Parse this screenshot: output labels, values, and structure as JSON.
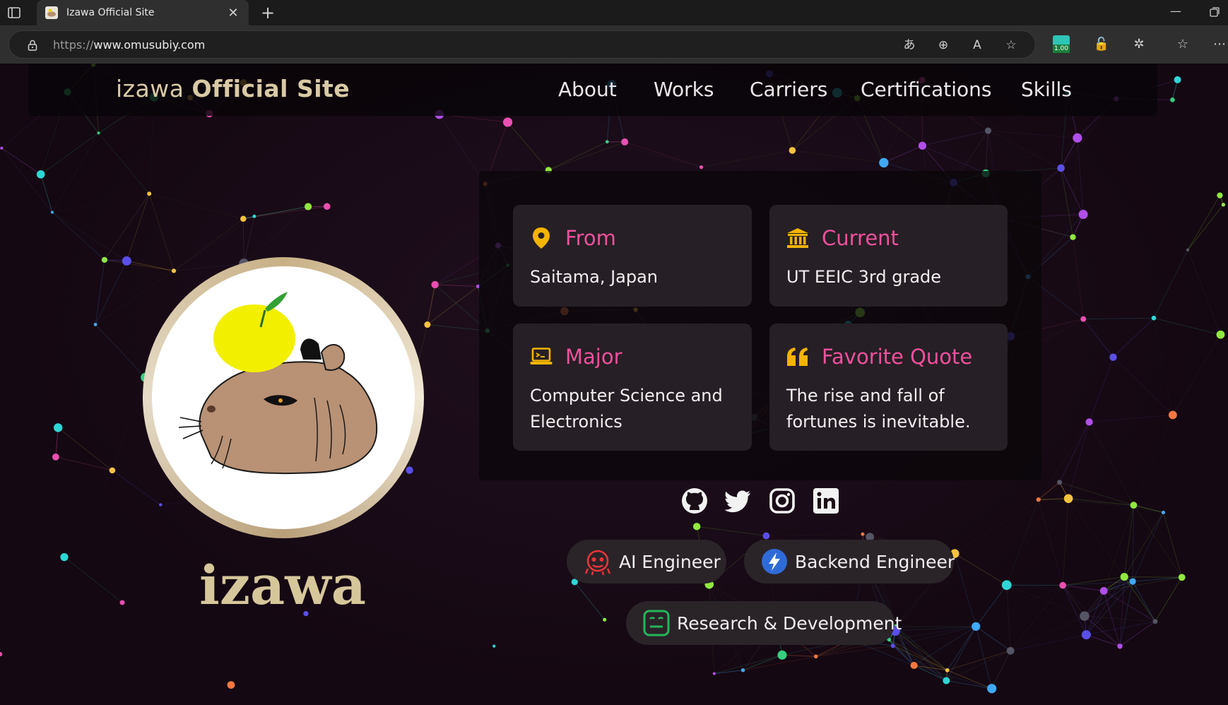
{
  "browser": {
    "tab_title": "Izawa Official Site",
    "url_scheme": "https://",
    "url_host": "www.omusubiy.com",
    "extension_badge": "1.00"
  },
  "navbar": {
    "title_light": "izawa",
    "title_bold": "Official Site",
    "links": [
      "About",
      "Works",
      "Carriers",
      "Certifications",
      "Skills"
    ]
  },
  "profile": {
    "name": "izawa"
  },
  "info_cards": [
    {
      "title": "From",
      "body": "Saitama, Japan",
      "icon": "location-pin-icon"
    },
    {
      "title": "Current",
      "body": "UT EEIC 3rd grade",
      "icon": "university-icon"
    },
    {
      "title": "Major",
      "body": "Computer Science and Electronics",
      "icon": "laptop-icon"
    },
    {
      "title": "Favorite Quote",
      "body": "The rise and fall of fortunes is inevitable.",
      "icon": "quote-icon"
    }
  ],
  "social": [
    "github-icon",
    "twitter-icon",
    "instagram-icon",
    "linkedin-icon"
  ],
  "roles": [
    {
      "label": "AI Engineer",
      "icon": "robot-icon"
    },
    {
      "label": "Backend Engineer",
      "icon": "lightning-icon"
    },
    {
      "label": "Research & Development",
      "icon": "lab-icon"
    }
  ],
  "colors": {
    "accent_pink": "#f0509d",
    "icon_gold": "#f4b400",
    "title_gold": "#d9caa5"
  }
}
